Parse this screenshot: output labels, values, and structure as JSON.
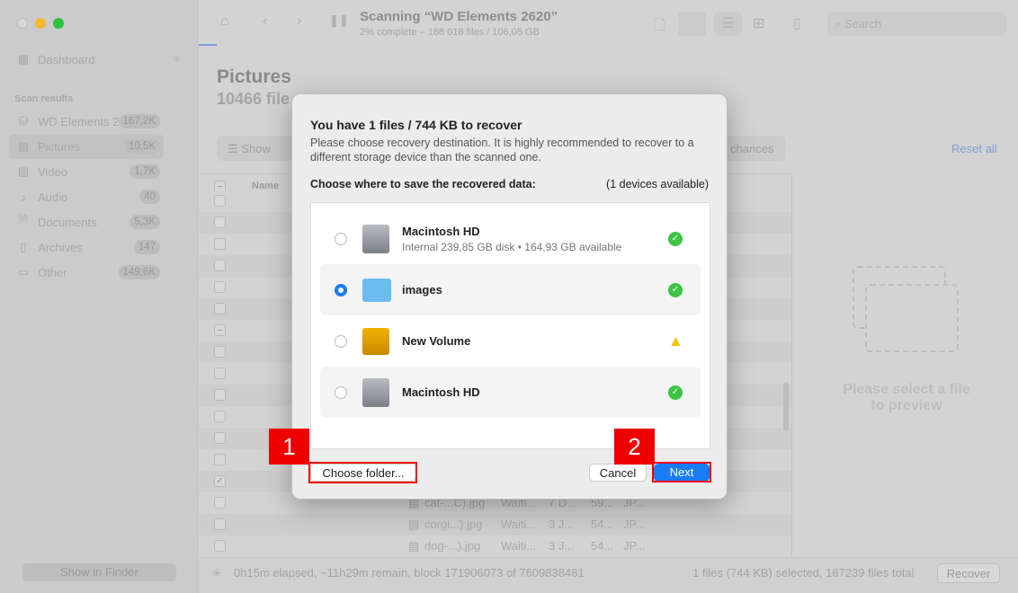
{
  "window": {
    "title": "Scanning “WD Elements 2620”",
    "subtitle": "2% complete – 168 016 files / 106,05 GB"
  },
  "toolbar": {
    "search_placeholder": "Search"
  },
  "sidebar": {
    "dashboard": "Dashboard",
    "section": "Scan results",
    "show_in_finder": "Show in Finder",
    "items": [
      {
        "label": "WD Elements 26...",
        "count": "167,2K",
        "icon": "drive-icon"
      },
      {
        "label": "Pictures",
        "count": "10,5K",
        "icon": "image-icon"
      },
      {
        "label": "Video",
        "count": "1,7K",
        "icon": "film-icon"
      },
      {
        "label": "Audio",
        "count": "40",
        "icon": "music-icon"
      },
      {
        "label": "Documents",
        "count": "5,3K",
        "icon": "document-icon"
      },
      {
        "label": "Archives",
        "count": "147",
        "icon": "archive-icon"
      },
      {
        "label": "Other",
        "count": "149,6K",
        "icon": "other-icon"
      }
    ]
  },
  "main": {
    "title": "Pictures",
    "subtitle": "10466 file",
    "show": "Show",
    "chances": "chances",
    "reset": "Reset all",
    "col_name": "Name",
    "rows": [
      {
        "name": "cat-...C).jpg",
        "status": "Waiti...",
        "date": "7 D...",
        "size": "59...",
        "kind": "JP..."
      },
      {
        "name": "corgi...).jpg",
        "status": "Waiti...",
        "date": "3 J...",
        "size": "54...",
        "kind": "JP..."
      },
      {
        "name": "dog-...).jpg",
        "status": "Waiti...",
        "date": "3 J...",
        "size": "54...",
        "kind": "JP..."
      }
    ],
    "preview": "Please select a file to preview"
  },
  "footer": {
    "elapsed": "0h15m elapsed, ~11h29m remain, block 171906073 of 7609838481",
    "selected": "1 files (744 KB) selected, 167239 files total",
    "recover": "Recover"
  },
  "dialog": {
    "title": "You have 1 files / 744 KB to recover",
    "desc": "Please choose recovery destination. It is highly recommended to recover to a different storage device than the scanned one.",
    "choose_label": "Choose where to save the recovered data:",
    "devices": "(1 devices available)",
    "destinations": [
      {
        "name": "Macintosh HD",
        "sub": "Internal 239,85 GB disk • 164,93 GB available",
        "status": "ok",
        "selected": false
      },
      {
        "name": "images",
        "sub": "",
        "status": "ok",
        "selected": true
      },
      {
        "name": "New Volume",
        "sub": "",
        "status": "warning",
        "selected": false
      },
      {
        "name": "Macintosh HD",
        "sub": "",
        "status": "ok",
        "selected": false
      }
    ],
    "choose_folder": "Choose folder...",
    "cancel": "Cancel",
    "next": "Next"
  },
  "annotations": {
    "one": "1",
    "two": "2",
    "color": "#ee0000"
  }
}
